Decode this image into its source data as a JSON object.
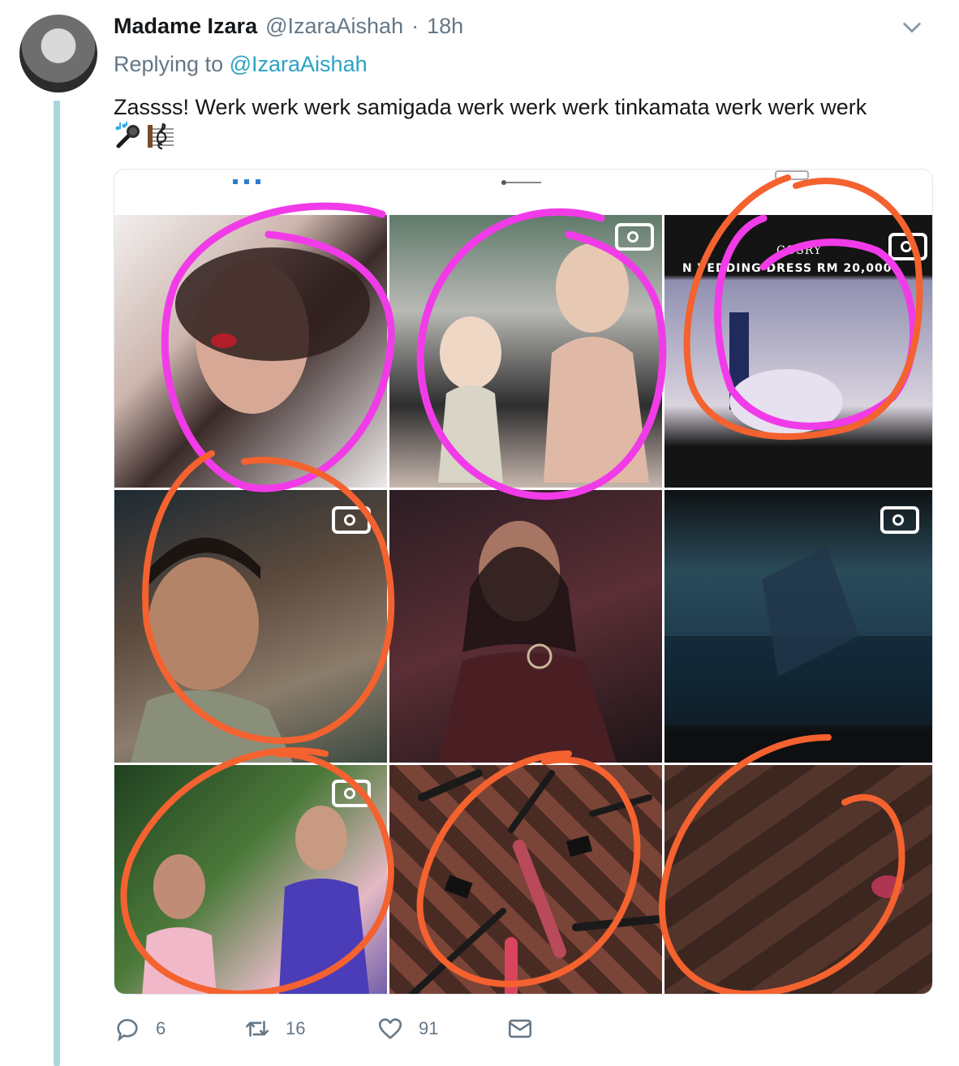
{
  "tweet": {
    "author_name": "Madame Izara",
    "author_handle": "@IzaraAishah",
    "separator": "·",
    "time": "18h",
    "replying_prefix": "Replying to",
    "replying_handle": "@IzaraAishah",
    "text": "Zassss! Werk werk werk samigada werk werk werk tinkamata werk werk werk",
    "emojis": [
      "🎤",
      "🎼"
    ]
  },
  "media": {
    "overlay_brand": "COSRY",
    "overlay_headline": "N  VEDDING DRESS RM 20,000",
    "annotation_colors": {
      "pink": "#f23be8",
      "orange": "#f4622f"
    }
  },
  "actions": {
    "replies": "6",
    "retweets": "16",
    "likes": "91"
  },
  "colors": {
    "thread_line": "#a7d8dd",
    "link": "#2aa3c4",
    "muted": "#657786"
  }
}
